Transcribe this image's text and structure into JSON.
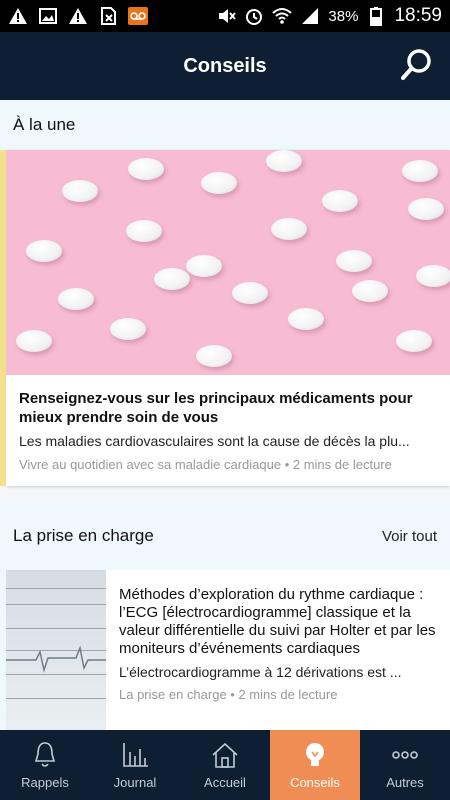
{
  "status": {
    "battery": "38%",
    "time": "18:59"
  },
  "header": {
    "title": "Conseils"
  },
  "featured_section": {
    "title": "À la une"
  },
  "featured": {
    "title": "Renseignez-vous sur les principaux médicaments pour mieux prendre soin de vous",
    "description": "Les maladies cardiovasculaires sont la cause de décès la plu...",
    "meta": "Vivre au quotidien avec sa maladie cardiaque • 2 mins de lecture"
  },
  "section2": {
    "title": "La prise en charge",
    "see_all": "Voir tout"
  },
  "article": {
    "title": "Méthodes d’exploration du rythme cardiaque : l’ECG [électrocardiogramme] classique et la valeur différentielle du suivi par Holter et par les moniteurs d’événements cardiaques",
    "description": "L’électrocardiogramme à 12 dérivations est ...",
    "meta": "La prise en charge • 2 mins de lecture"
  },
  "nav": [
    {
      "label": "Rappels",
      "icon": "bell-icon"
    },
    {
      "label": "Journal",
      "icon": "chart-icon"
    },
    {
      "label": "Accueil",
      "icon": "home-icon"
    },
    {
      "label": "Conseils",
      "icon": "lightbulb-icon",
      "active": true
    },
    {
      "label": "Autres",
      "icon": "more-icon"
    }
  ],
  "colors": {
    "header": "#0e1f33",
    "accent": "#f08d54",
    "section_bg": "#eef8fd"
  }
}
